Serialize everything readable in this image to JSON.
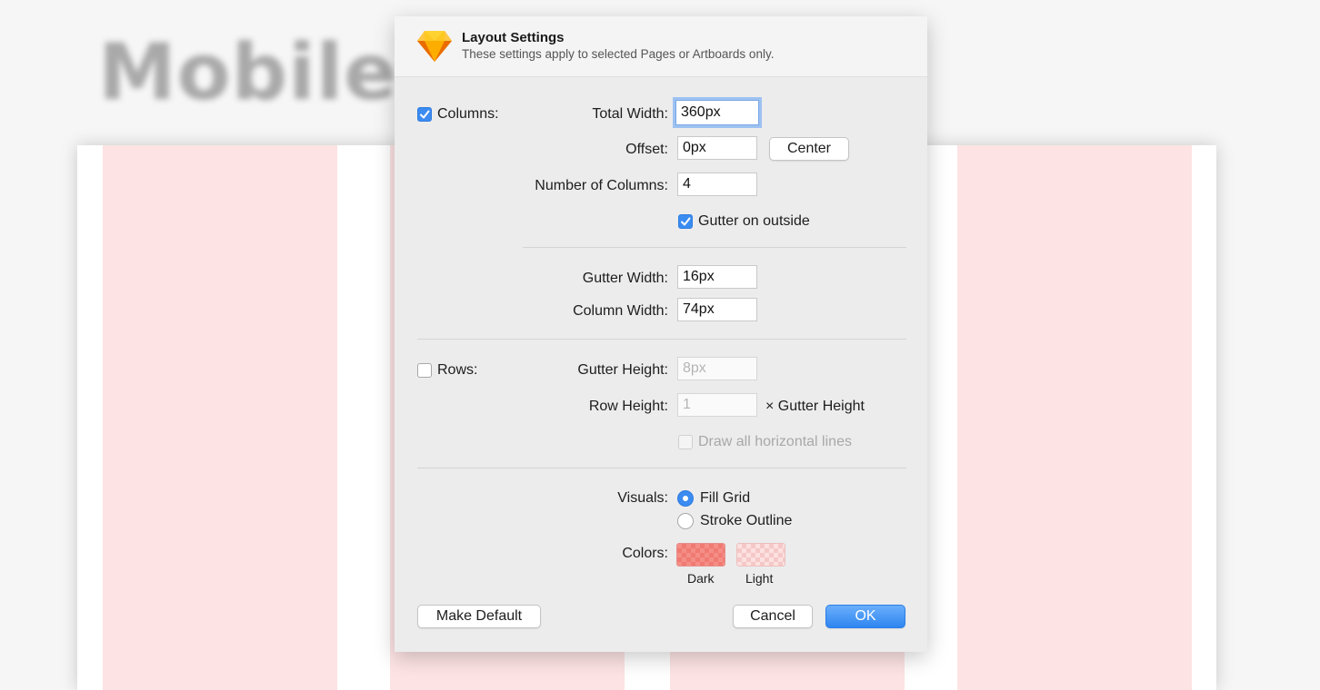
{
  "background": {
    "title": "Mobile",
    "column_color": "#fde3e3"
  },
  "dialog": {
    "app_icon": "sketch-diamond-icon",
    "title": "Layout Settings",
    "subtitle": "These settings apply to selected Pages or Artboards only.",
    "columns": {
      "label": "Columns:",
      "checked": true,
      "total_width_label": "Total Width:",
      "total_width_value": "360px",
      "offset_label": "Offset:",
      "offset_value": "0px",
      "center_button": "Center",
      "number_label": "Number of Columns:",
      "number_value": "4",
      "gutter_outside_label": "Gutter on outside",
      "gutter_outside_checked": true,
      "gutter_width_label": "Gutter Width:",
      "gutter_width_value": "16px",
      "column_width_label": "Column Width:",
      "column_width_value": "74px"
    },
    "rows": {
      "label": "Rows:",
      "checked": false,
      "gutter_height_label": "Gutter Height:",
      "gutter_height_value": "8px",
      "row_height_label": "Row Height:",
      "row_height_value": "1",
      "row_height_suffix": "× Gutter Height",
      "draw_lines_label": "Draw all horizontal lines",
      "draw_lines_checked": false
    },
    "visuals": {
      "label": "Visuals:",
      "fill_grid": "Fill Grid",
      "stroke_outline": "Stroke Outline",
      "selected": "Fill Grid"
    },
    "colors": {
      "label": "Colors:",
      "dark_label": "Dark",
      "light_label": "Light",
      "dark_color": "#f48e87",
      "light_color": "#fbe1e0"
    },
    "buttons": {
      "make_default": "Make Default",
      "cancel": "Cancel",
      "ok": "OK"
    },
    "accent_color": "#3b8bf1"
  }
}
